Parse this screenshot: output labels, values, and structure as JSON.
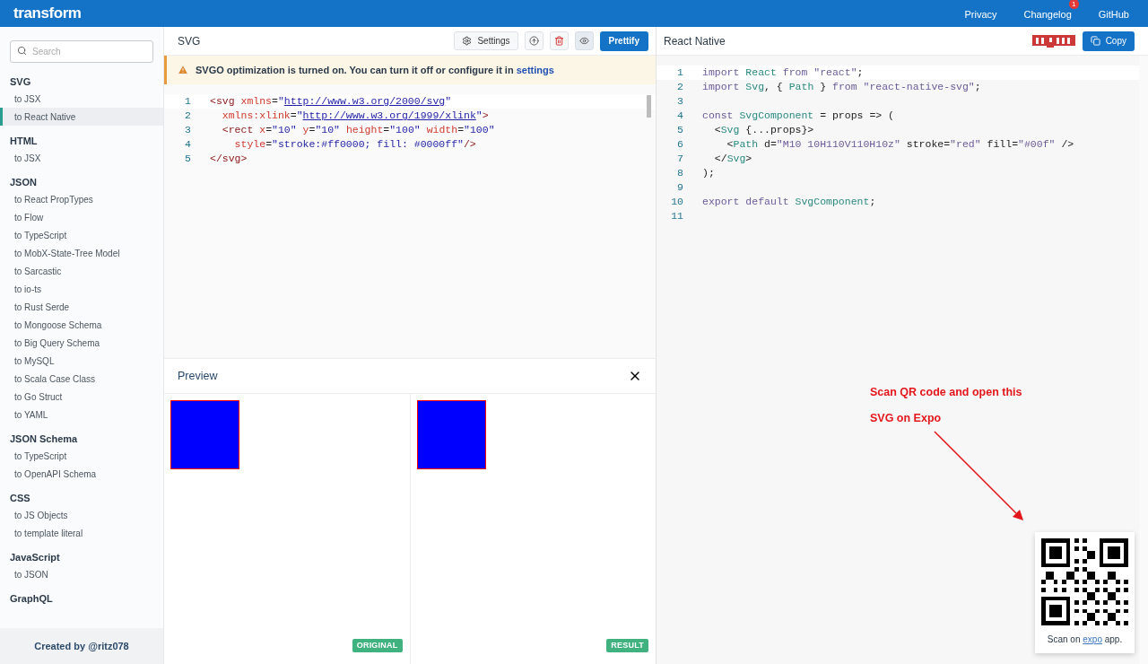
{
  "header": {
    "logo": "transform",
    "nav": [
      {
        "label": "Privacy"
      },
      {
        "label": "Changelog",
        "badge": "1"
      },
      {
        "label": "GitHub"
      }
    ]
  },
  "sidebar": {
    "search": {
      "placeholder": "Search"
    },
    "groups": [
      {
        "title": "SVG",
        "items": [
          {
            "label": "to JSX",
            "selected": false
          },
          {
            "label": "to React Native",
            "selected": true
          }
        ]
      },
      {
        "title": "HTML",
        "items": [
          {
            "label": "to JSX",
            "selected": false
          }
        ]
      },
      {
        "title": "JSON",
        "items": [
          {
            "label": "to React PropTypes",
            "selected": false
          },
          {
            "label": "to Flow",
            "selected": false
          },
          {
            "label": "to TypeScript",
            "selected": false
          },
          {
            "label": "to MobX-State-Tree Model",
            "selected": false
          },
          {
            "label": "to Sarcastic",
            "selected": false
          },
          {
            "label": "to io-ts",
            "selected": false
          },
          {
            "label": "to Rust Serde",
            "selected": false
          },
          {
            "label": "to Mongoose Schema",
            "selected": false
          },
          {
            "label": "to Big Query Schema",
            "selected": false
          },
          {
            "label": "to MySQL",
            "selected": false
          },
          {
            "label": "to Scala Case Class",
            "selected": false
          },
          {
            "label": "to Go Struct",
            "selected": false
          },
          {
            "label": "to YAML",
            "selected": false
          }
        ]
      },
      {
        "title": "JSON Schema",
        "items": [
          {
            "label": "to TypeScript",
            "selected": false
          },
          {
            "label": "to OpenAPI Schema",
            "selected": false
          }
        ]
      },
      {
        "title": "CSS",
        "items": [
          {
            "label": "to JS Objects",
            "selected": false
          },
          {
            "label": "to template literal",
            "selected": false
          }
        ]
      },
      {
        "title": "JavaScript",
        "items": [
          {
            "label": "to JSON",
            "selected": false
          }
        ]
      },
      {
        "title": "GraphQL"
      }
    ],
    "footer": "Created by @ritz078"
  },
  "input_panel": {
    "title": "SVG",
    "toolbar": [
      {
        "kind": "settings",
        "label": "Settings"
      },
      {
        "kind": "upload"
      },
      {
        "kind": "delete"
      },
      {
        "kind": "preview",
        "active": true
      },
      {
        "kind": "prettify",
        "label": "Prettify"
      }
    ],
    "alert": {
      "text": "SVGO optimization is turned on. You can turn it off or configure it in",
      "link": "settings"
    },
    "lines": [
      {
        "number": "1",
        "text": "<svg xmlns=\"http://www.w3.org/2000/svg\""
      },
      {
        "number": "2",
        "text": "  xmlns:xlink=\"http://www.w3.org/1999/xlink\">"
      },
      {
        "number": "3",
        "text": "  <rect x=\"10\" y=\"10\" height=\"100\" width=\"100\""
      },
      {
        "number": "4",
        "text": "    style=\"stroke:#ff0000; fill: #0000ff\"/>"
      },
      {
        "number": "5",
        "text": "</svg>"
      }
    ]
  },
  "preview": {
    "title": "Preview",
    "panes": [
      {
        "badge": "ORIGINAL"
      },
      {
        "badge": "RESULT"
      }
    ]
  },
  "output_panel": {
    "title": "React Native",
    "copy": "Copy",
    "lines": [
      {
        "number": "1",
        "text": "import React from \"react\";"
      },
      {
        "number": "2",
        "text": "import Svg, { Path } from \"react-native-svg\";"
      },
      {
        "number": "3"
      },
      {
        "number": "4",
        "text": "const SvgComponent = props => ("
      },
      {
        "number": "5",
        "text": "  <Svg {...props}>"
      },
      {
        "number": "6",
        "text": "    <Path d=\"M10 10H110V110H10z\" stroke=\"red\" fill=\"#00f\" />"
      },
      {
        "number": "7",
        "text": "  </Svg>"
      },
      {
        "number": "8",
        "text": ");"
      },
      {
        "number": "9"
      },
      {
        "number": "10",
        "text": "export default SvgComponent;"
      },
      {
        "number": "11"
      }
    ],
    "annotation": [
      "Scan QR code and open this",
      "SVG on Expo"
    ],
    "qr": {
      "caption_before": "Scan on",
      "link": "expo",
      "caption_after": "app."
    }
  }
}
